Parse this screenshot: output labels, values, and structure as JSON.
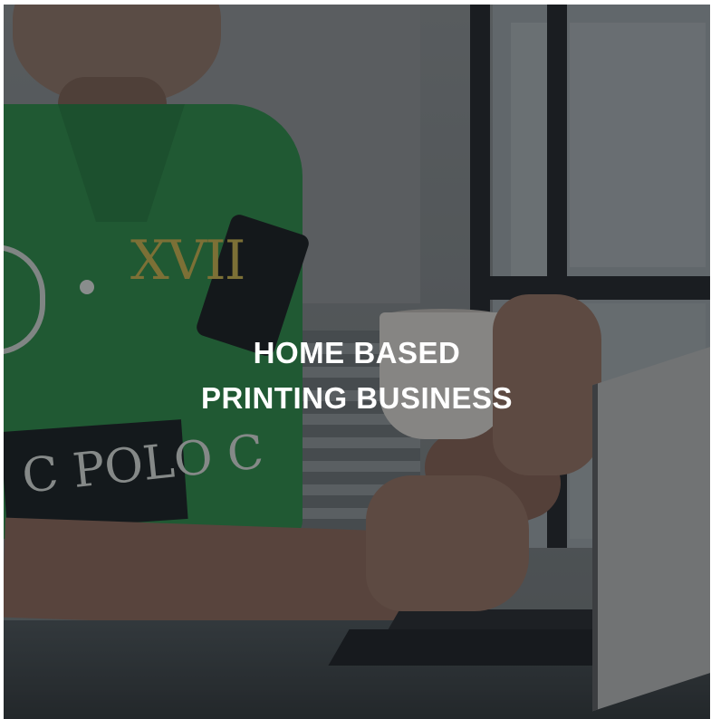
{
  "hero": {
    "headline_line1": "HOME BASED",
    "headline_line2": "PRINTING BUSINESS",
    "shirt_text_number": "XVII",
    "shirt_text_brand": "C POLO C"
  },
  "colors": {
    "shirt_green": "#2a8a45",
    "overlay": "#12161a",
    "headline_text": "#ffffff"
  }
}
